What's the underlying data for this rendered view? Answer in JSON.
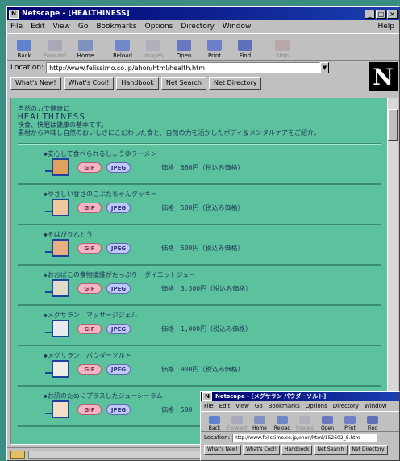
{
  "window": {
    "title": "Netscape - [HEALTHINESS]",
    "menu": [
      "File",
      "Edit",
      "View",
      "Go",
      "Bookmarks",
      "Options",
      "Directory",
      "Window"
    ],
    "help": "Help",
    "toolbar": [
      "Back",
      "Forward",
      "Home",
      "Reload",
      "Images",
      "Open",
      "Print",
      "Find",
      "Stop"
    ],
    "location_label": "Location:",
    "location_value": "http://www.felissimo.co.jp/ehon/html/health.htm",
    "directory_buttons": [
      "What's New!",
      "What's Cool!",
      "Handbook",
      "Net Search",
      "Net Directory"
    ]
  },
  "page": {
    "intro": "自然の力で健康に",
    "title": "HEALTHINESS",
    "desc1": "快食、快眠は健康の基本です。",
    "desc2": "素材から吟味し自然のおいしさにこだわった食と、自然の力を活かしたボディ＆メンタルケアをご紹介。",
    "gif_label": "GIF",
    "jpeg_label": "JPEG",
    "items": [
      {
        "name": "◆安心して食べられるしょうゆラーメン",
        "price": "価格　680円（税込み価格）"
      },
      {
        "name": "◆やさしい甘さのこぶたちゃんクッキー",
        "price": "価格　500円（税込み価格）"
      },
      {
        "name": "◆そばがりんとう",
        "price": "価格　500円（税込み価格）"
      },
      {
        "name": "◆おおばこの食物繊維がたっぷり　ダイエットジュー",
        "price": "価格　3,300円（税込み価格）"
      },
      {
        "name": "◆メグサラン　マッサージジェル",
        "price": "価格　1,000円（税込み価格）"
      },
      {
        "name": "◆メグサラン　パウダーソルト",
        "price": "価格　900円（税込み価格）"
      },
      {
        "name": "◆お肌のためにプラスしたジューシーラム",
        "price": "価格　500"
      }
    ]
  },
  "popup": {
    "title": "Netscape - [メグサラン パウダーソルト]",
    "menu": [
      "File",
      "Edit",
      "View",
      "Go",
      "Bookmarks",
      "Options",
      "Directory",
      "Window"
    ],
    "toolbar": [
      "Back",
      "Forward",
      "Home",
      "Reload",
      "Images",
      "Open",
      "Print",
      "Find"
    ],
    "location_label": "Location:",
    "location_value": "http://www.felissimo.co.jp/ehon/html/152602_8.htm",
    "directory_buttons": [
      "What's New!",
      "What's Cool!",
      "Handbook",
      "Net Search",
      "Net Directory"
    ]
  },
  "colors": {
    "page_bg": "#5cc29e",
    "title_bar": "#00006e",
    "text": "#203858"
  }
}
